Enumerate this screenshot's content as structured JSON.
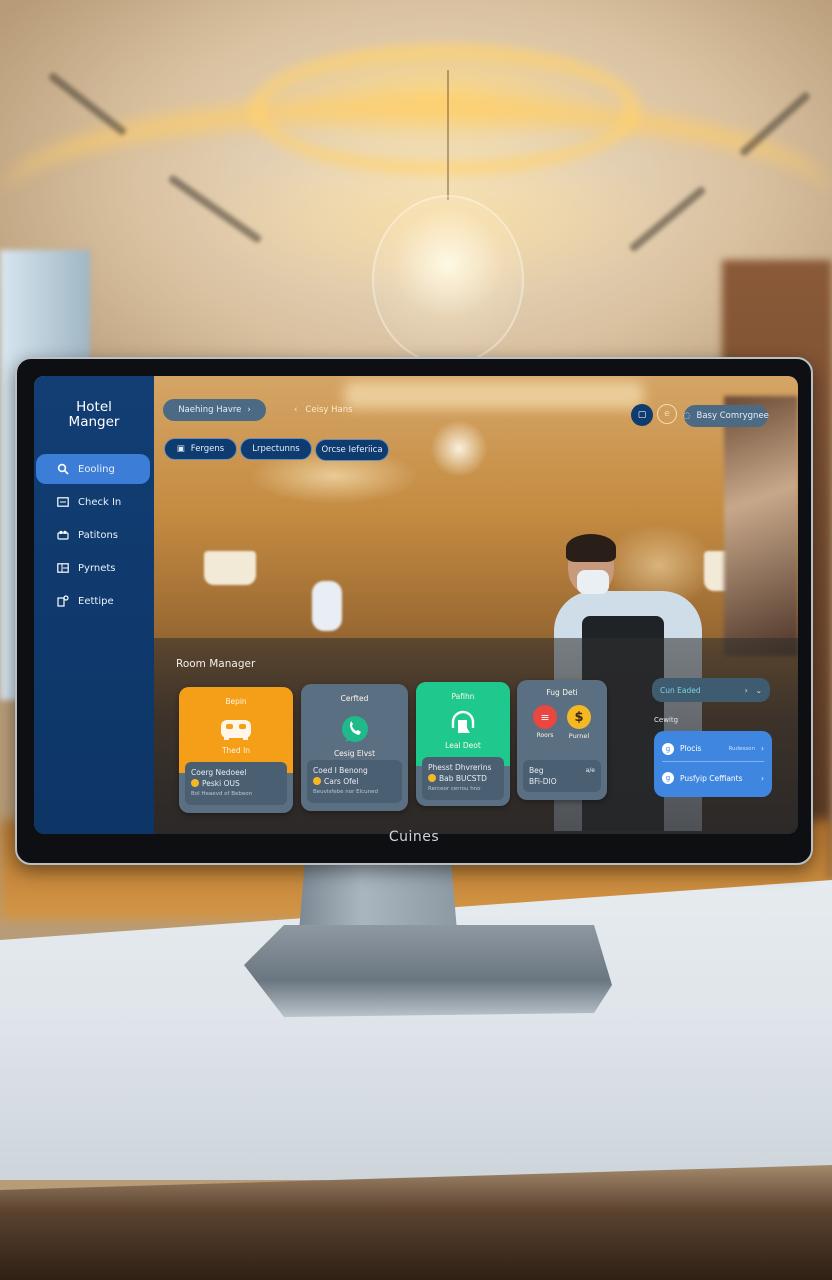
{
  "monitor": {
    "brand": "Cuines"
  },
  "app": {
    "title": "Hotel\nManger"
  },
  "sidebar": {
    "items": [
      {
        "label": "Eooling",
        "icon": "search-icon",
        "active": true
      },
      {
        "label": "Check In",
        "icon": "monitor-icon",
        "active": false
      },
      {
        "label": "Patitons",
        "icon": "group-icon",
        "active": false
      },
      {
        "label": "Pyrnets",
        "icon": "calculator-icon",
        "active": false
      },
      {
        "label": "Eettipe",
        "icon": "settings-device-icon",
        "active": false
      }
    ]
  },
  "topbar": {
    "nav_pill": "Naehing Havre",
    "breadcrumb": "Ceisy Hans",
    "action_pills": [
      "Fergens",
      "Lrpectunns",
      "Orcse Ieferiica"
    ],
    "profile_pill": "Basy Comrygnee"
  },
  "room_manager": {
    "title": "Room Manager",
    "cards": [
      {
        "name": "check-in-card",
        "header": "Bepin",
        "caption": "Thed In",
        "icon": "bed-icon",
        "color": "#f59e17",
        "footer_title": "Coerg Nedoeel",
        "footer_value": "Peski OUS",
        "footer_note": "Bol Heaevd of Bebeon"
      },
      {
        "name": "contact-card",
        "header": "Cerfted",
        "caption": "Cesig Elvst",
        "icon": "phone-chat-icon",
        "color": "#5a6f82",
        "footer_title": "Coed I Benong",
        "footer_value": "Cars Ofel",
        "footer_note": "Beuvisfebe nor Elcuned"
      },
      {
        "name": "service-card",
        "header": "Pafihn",
        "caption": "Leal Deot",
        "icon": "headset-icon",
        "color": "#1fc98d",
        "footer_title": "Phesst Dhvrerins",
        "footer_value": "Bab BUCSTD",
        "footer_note": "Rerceor cerrou hno"
      },
      {
        "name": "payment-card",
        "header": "Fug Deti",
        "icons": [
          {
            "label": "Roors",
            "icon": "menu-icon",
            "color": "#e9473f"
          },
          {
            "label": "Purnel",
            "icon": "dollar-icon",
            "color": "#f4b824"
          }
        ],
        "footer_title": "Beg",
        "footer_value": "BFi-DIO",
        "footer_badge": "a/e"
      }
    ],
    "list": {
      "header": "Cun Eaded",
      "section_label": "Cewitg",
      "rows": [
        {
          "name": "Plocis",
          "meta": "Rudesson"
        },
        {
          "name": "Pusfyip Ceffiants",
          "meta": ""
        }
      ]
    }
  }
}
